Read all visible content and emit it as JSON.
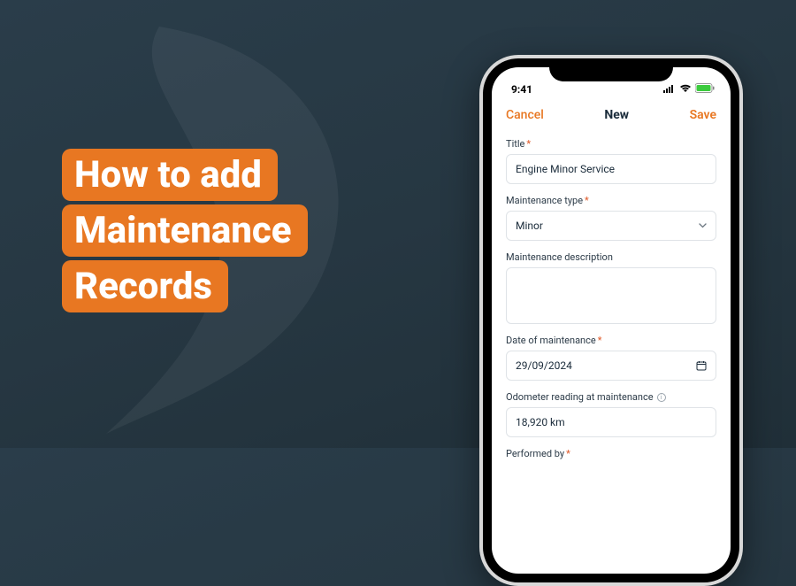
{
  "headline": {
    "line1": "How to add",
    "line2": "Maintenance",
    "line3": "Records"
  },
  "statusbar": {
    "time": "9:41"
  },
  "navbar": {
    "cancel": "Cancel",
    "title": "New",
    "save": "Save"
  },
  "form": {
    "title": {
      "label": "Title",
      "value": "Engine Minor Service"
    },
    "maintenance_type": {
      "label": "Maintenance type",
      "value": "Minor"
    },
    "maintenance_description": {
      "label": "Maintenance description",
      "value": ""
    },
    "date_of_maintenance": {
      "label": "Date of maintenance",
      "value": "29/09/2024"
    },
    "odometer": {
      "label": "Odometer reading at maintenance",
      "value": "18,920 km"
    },
    "performed_by": {
      "label": "Performed by"
    }
  },
  "required_marker": "*"
}
